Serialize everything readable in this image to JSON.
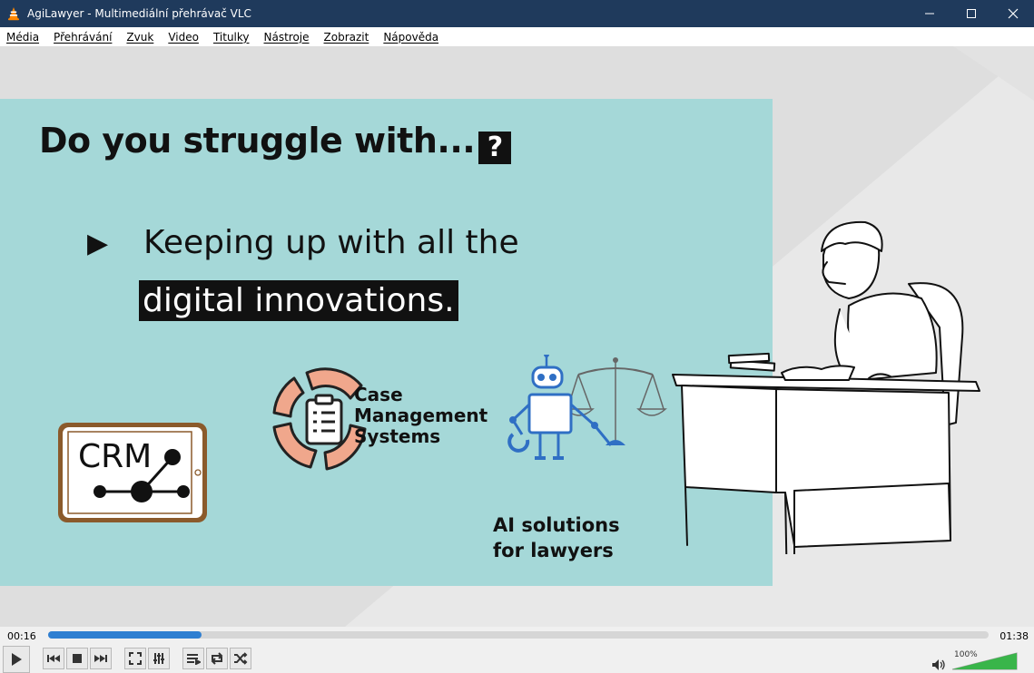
{
  "window": {
    "title": "AgiLawyer - Multimediální přehrávač VLC"
  },
  "menu": [
    {
      "label": "Média"
    },
    {
      "label": "Přehrávání"
    },
    {
      "label": "Zvuk"
    },
    {
      "label": "Video"
    },
    {
      "label": "Titulky"
    },
    {
      "label": "Nástroje"
    },
    {
      "label": "Zobrazit"
    },
    {
      "label": "Nápověda"
    }
  ],
  "slide": {
    "heading": "Do you struggle with...",
    "heading_glyph": "?",
    "bullet_marker": "▶",
    "bullet_line1": "Keeping up with all the",
    "bullet_line2": "digital innovations.",
    "crm_label": "CRM",
    "cms_line1": "Case",
    "cms_line2": "Management",
    "cms_line3": "Systems",
    "ai_line1": "AI solutions",
    "ai_line2": "for lawyers"
  },
  "player": {
    "current_time": "00:16",
    "total_time": "01:38",
    "progress": 0.163,
    "volume_label": "100%",
    "volume": 1.0
  },
  "colors": {
    "titlebar": "#1f3a5c",
    "slide_bg": "#a5d8d8",
    "seek_fill": "#2f7fd1",
    "cms_accent": "#f0a78c",
    "robot_blue": "#2f6fc4",
    "volume_green": "#39b54a"
  },
  "icons": {
    "app": "vlc-cone-icon",
    "minimize": "minimize-icon",
    "maximize": "maximize-icon",
    "close": "close-icon",
    "play": "play-icon",
    "prev": "previous-icon",
    "stop": "stop-icon",
    "next": "next-icon",
    "fullscreen": "fullscreen-icon",
    "extended": "equalizer-icon",
    "playlist": "playlist-icon",
    "loop": "loop-icon",
    "shuffle": "shuffle-icon",
    "volume": "speaker-icon"
  }
}
